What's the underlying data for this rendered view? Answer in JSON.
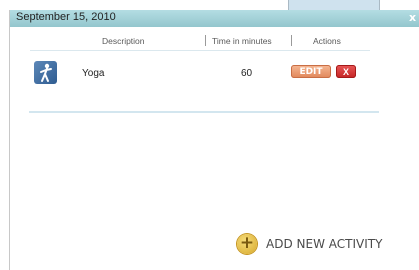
{
  "dialog": {
    "date": "September 15, 2010",
    "close_label": "x"
  },
  "columns": {
    "description": "Description",
    "time": "Time in minutes",
    "actions": "Actions"
  },
  "activities": [
    {
      "icon": "yoga-person-icon",
      "name": "Yoga",
      "minutes": "60",
      "edit_label": "EDIT",
      "delete_label": "X"
    }
  ],
  "add_activity": {
    "icon": "plus-circle-icon",
    "label": "ADD NEW ACTIVITY"
  },
  "colors": {
    "header": "#a7d4da",
    "edit_button": "#e98a5b",
    "delete_button": "#d22c2c",
    "add_icon": "#e6be44"
  }
}
